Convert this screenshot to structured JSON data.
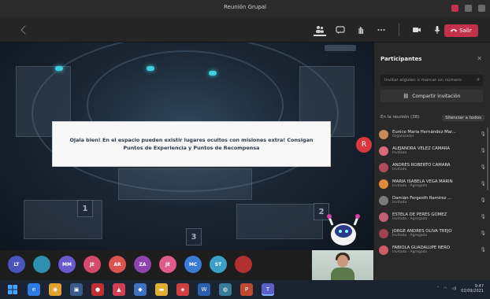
{
  "window": {
    "title": "Reunión Grupal"
  },
  "toolbar": {
    "leave_label": "Salir"
  },
  "stage": {
    "notice_text": "Ojala bien! En el espacio pueden existir lugares ocultos con misiones extra! Consigan Puntos de Experiencia y Puntos de Recompensa",
    "tiles": [
      "1",
      "2",
      "3"
    ],
    "record_badge": "R"
  },
  "strip": {
    "avatars": [
      {
        "initials": "LT",
        "color": "#4b53bc"
      },
      {
        "initials": "",
        "color": "#2f8fb0"
      },
      {
        "initials": "MM",
        "color": "#6a5acd"
      },
      {
        "initials": "JE",
        "color": "#d44a6a"
      },
      {
        "initials": "AR",
        "color": "#d9534f"
      },
      {
        "initials": "ZA",
        "color": "#8e44ad"
      },
      {
        "initials": "JE",
        "color": "#e05a8a"
      },
      {
        "initials": "MC",
        "color": "#3a7bd5"
      },
      {
        "initials": "ST",
        "color": "#3aa0c8"
      },
      {
        "initials": "",
        "color": "#b03030"
      }
    ]
  },
  "panel": {
    "title": "Participantes",
    "search_placeholder": "Invitar alguien o marcar un número",
    "share_label": "Compartir invitación",
    "section_label": "En la reunión (38)",
    "mute_all_label": "Silenciar a todos",
    "people": [
      {
        "name": "Eunice María Hernández Mar...",
        "role": "Organizador",
        "color": "#c98a5a"
      },
      {
        "name": "ALEJANDRA VELEZ CAMARA",
        "role": "Invitado",
        "color": "#d86a7a"
      },
      {
        "name": "ANDRÉS ROBERTO CAMARA",
        "role": "Invitado",
        "color": "#b04a5a"
      },
      {
        "name": "MARÍA ISABELA VEGA MARIN",
        "role": "Invitado · Agregado",
        "color": "#e08a3a"
      },
      {
        "name": "Damián Fergesth Ramírez ...",
        "role": "Invitado",
        "color": "#7a7a7a"
      },
      {
        "name": "ESTELA DE PERÉS GÓMEZ",
        "role": "Invitado · Agregado",
        "color": "#c06070"
      },
      {
        "name": "JORGE ANDRÉS OLIVA TREJO",
        "role": "Invitado · Agregado",
        "color": "#a04050"
      },
      {
        "name": "FABIOLA GUADALUPE NERO",
        "role": "Invitado · Agregado",
        "color": "#d05a6a"
      }
    ]
  },
  "taskbar": {
    "time": "9:47",
    "date": "02/09/2021"
  }
}
